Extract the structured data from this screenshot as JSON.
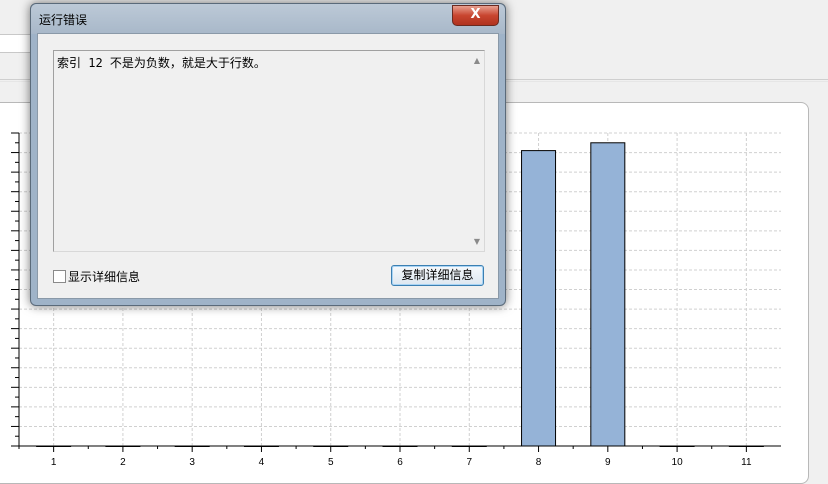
{
  "dialog": {
    "title": "运行错误",
    "close_label": "X",
    "message": "索引 12 不是为负数，就是大于行数。",
    "show_details_label": "显示详细信息",
    "copy_details_label": "复制详细信息"
  },
  "chart_data": {
    "type": "bar",
    "categories": [
      "1",
      "2",
      "3",
      "4",
      "5",
      "6",
      "7",
      "8",
      "9",
      "10",
      "11"
    ],
    "values": [
      0,
      0,
      0,
      0,
      0,
      0,
      0,
      15.1,
      15.5,
      0,
      0
    ],
    "ylim": [
      0,
      16
    ],
    "grid": true,
    "bar_color": "#95b3d7"
  }
}
